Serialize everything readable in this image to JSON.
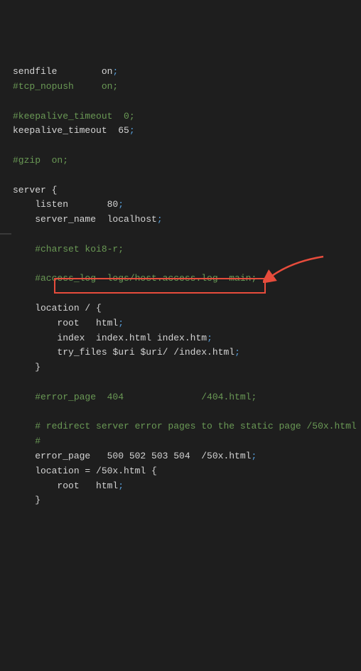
{
  "lines": [
    {
      "type": "kv",
      "key": "sendfile",
      "pad": "        ",
      "value": "on"
    },
    {
      "type": "comment",
      "text": "#tcp_nopush     on;"
    },
    {
      "type": "blank"
    },
    {
      "type": "comment",
      "text": "#keepalive_timeout  0;"
    },
    {
      "type": "kv",
      "key": "keepalive_timeout",
      "pad": "  ",
      "value": "65"
    },
    {
      "type": "blank"
    },
    {
      "type": "comment",
      "text": "#gzip  on;"
    },
    {
      "type": "blank"
    },
    {
      "type": "plain",
      "text": "server {"
    },
    {
      "type": "kv",
      "indent": "    ",
      "key": "listen",
      "pad": "       ",
      "value": "80"
    },
    {
      "type": "kv",
      "indent": "    ",
      "key": "server_name",
      "pad": "  ",
      "value": "localhost"
    },
    {
      "type": "blank"
    },
    {
      "type": "comment",
      "indent": "    ",
      "text": "#charset koi8-r;"
    },
    {
      "type": "blank"
    },
    {
      "type": "comment",
      "indent": "    ",
      "text": "#access_log  logs/host.access.log  main;"
    },
    {
      "type": "blank"
    },
    {
      "type": "plain",
      "indent": "    ",
      "text": "location / {"
    },
    {
      "type": "kv",
      "indent": "        ",
      "key": "root",
      "pad": "   ",
      "value": "html"
    },
    {
      "type": "kv",
      "indent": "        ",
      "key": "index",
      "pad": "  ",
      "value": "index.html index.htm"
    },
    {
      "type": "kv",
      "indent": "        ",
      "key": "try_files",
      "pad": " ",
      "value": "$uri $uri/ /index.html"
    },
    {
      "type": "plain",
      "indent": "    ",
      "text": "}"
    },
    {
      "type": "blank"
    },
    {
      "type": "comment",
      "indent": "    ",
      "text": "#error_page  404              /404.html;"
    },
    {
      "type": "blank"
    },
    {
      "type": "comment",
      "indent": "    ",
      "text": "# redirect server error pages to the static page /50x.html"
    },
    {
      "type": "comment",
      "indent": "    ",
      "text": "#"
    },
    {
      "type": "kv",
      "indent": "    ",
      "key": "error_page",
      "pad": "   ",
      "value": "500 502 503 504  /50x.html"
    },
    {
      "type": "plain",
      "indent": "    ",
      "text": "location = /50x.html {"
    },
    {
      "type": "kv",
      "indent": "        ",
      "key": "root",
      "pad": "   ",
      "value": "html"
    },
    {
      "type": "plain",
      "indent": "    ",
      "text": "}"
    }
  ],
  "semicolon": ";",
  "highlight_color": "#e74c3c",
  "arrow_color": "#e74c3c"
}
